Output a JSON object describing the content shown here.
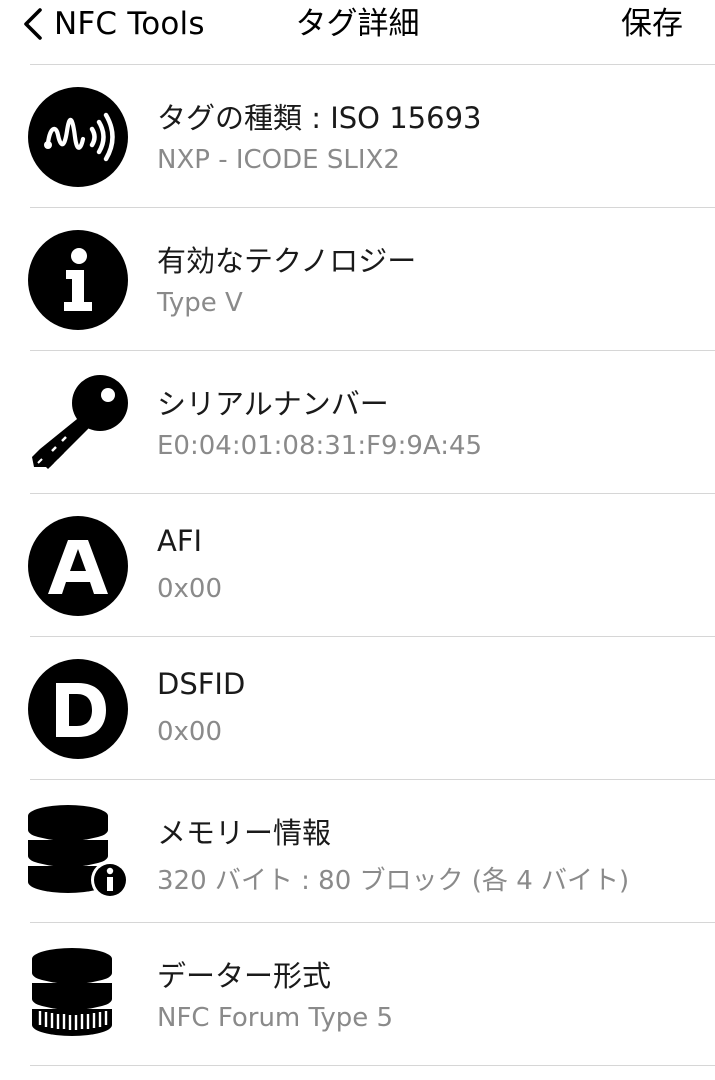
{
  "nav": {
    "back_label": "NFC Tools",
    "title": "タグ詳細",
    "save_label": "保存"
  },
  "rows": [
    {
      "title": "タグの種類 : ISO 15693",
      "subtitle": "NXP - ICODE SLIX2",
      "icon": "nfc-wave-icon"
    },
    {
      "title": "有効なテクノロジー",
      "subtitle": "Type V",
      "icon": "info-icon"
    },
    {
      "title": "シリアルナンバー",
      "subtitle": "E0:04:01:08:31:F9:9A:45",
      "icon": "key-icon"
    },
    {
      "title": "AFI",
      "subtitle": "0x00",
      "icon": "letter-a-icon"
    },
    {
      "title": "DSFID",
      "subtitle": "0x00",
      "icon": "letter-d-icon"
    },
    {
      "title": "メモリー情報",
      "subtitle": "320 バイト : 80 ブロック (各 4 バイト)",
      "icon": "database-info-icon"
    },
    {
      "title": "データー形式",
      "subtitle": "NFC Forum Type 5",
      "icon": "database-format-icon"
    }
  ],
  "colors": {
    "icon": "#000000",
    "subtitle": "#8a8a8a",
    "divider": "#d6d6d6"
  }
}
